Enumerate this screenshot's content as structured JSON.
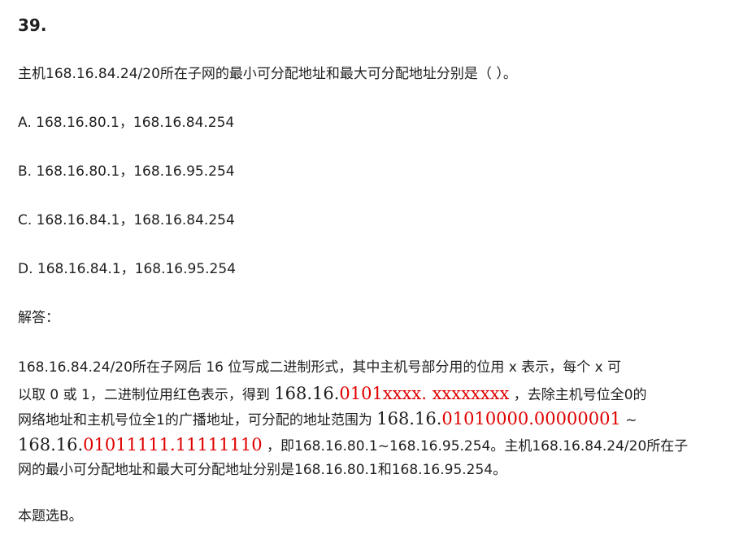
{
  "question": {
    "number": "39.",
    "stem": "主机168.16.84.24/20所在子网的最小可分配地址和最大可分配地址分别是（ ）。",
    "options": [
      "A. 168.16.80.1，168.16.84.254",
      "B. 168.16.80.1，168.16.95.254",
      "C. 168.16.84.1，168.16.84.254",
      "D. 168.16.84.1，168.16.95.254"
    ]
  },
  "answer": {
    "label": "解答：",
    "line1": "168.16.84.24/20所在子网后 16 位写成二进制形式，其中主机号部分用的位用 x 表示，每个 x 可",
    "line2_a": "以取 0 或 1，二进制位用红色表示，得到 ",
    "line2_b_black": "168.16.",
    "line2_b_red": "0101xxxx. xxxxxxxx",
    "line2_c": " ，去除主机号位全0的",
    "line3_a": "网络地址和主机号位全1的广播地址，可分配的地址范围为 ",
    "line3_b_black": "168.16.",
    "line3_b_red": "01010000.00000001",
    "line3_c": " ~",
    "line4_a_black": "168.16.",
    "line4_a_red": "01011111.11111110",
    "line4_b": " ，即168.16.80.1~168.16.95.254。主机168.16.84.24/20所在子",
    "line5": "网的最小可分配地址和最大可分配地址分别是168.16.80.1和168.16.95.254。",
    "conclusion": "本题选B。"
  },
  "colors": {
    "text": "#1f1f1f",
    "highlight_red": "#e00000"
  }
}
